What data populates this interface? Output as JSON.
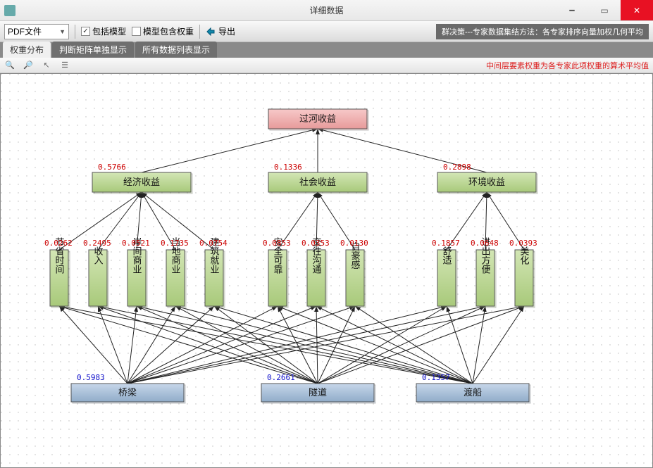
{
  "window": {
    "title": "详细数据"
  },
  "toolbar": {
    "pdf_dropdown": "PDF文件",
    "chk_include_model": "包括模型",
    "chk_include_model_checked": true,
    "chk_model_with_weights": "模型包含权重",
    "chk_model_with_weights_checked": false,
    "export_label": "导出",
    "status_right": "群决策---专家数据集结方法：各专家排序向量加权几何平均"
  },
  "tabs": {
    "t1": "权重分布",
    "t2": "判断矩阵单独显示",
    "t3": "所有数据列表显示",
    "active": 0
  },
  "hint_right": "中间层要素权重为各专家此项权重的算术平均值",
  "chart_data": {
    "type": "hierarchy-diagram",
    "goal": {
      "label": "过河收益"
    },
    "criteria": [
      {
        "id": "c1",
        "label": "经济收益",
        "weight": 0.5766
      },
      {
        "id": "c2",
        "label": "社会收益",
        "weight": 0.1336
      },
      {
        "id": "c3",
        "label": "环境收益",
        "weight": 0.2898
      }
    ],
    "subcriteria": [
      {
        "id": "s1",
        "parent": "c1",
        "label": "节省时间",
        "weight": 0.0262
      },
      {
        "id": "s2",
        "parent": "c1",
        "label": "收入",
        "weight": 0.2495
      },
      {
        "id": "s3",
        "parent": "c1",
        "label": "岸间商业",
        "weight": 0.0521
      },
      {
        "id": "s4",
        "parent": "c1",
        "label": "当地商业",
        "weight": 0.1735
      },
      {
        "id": "s5",
        "parent": "c1",
        "label": "建筑就业",
        "weight": 0.0754
      },
      {
        "id": "s6",
        "parent": "c2",
        "label": "安全可靠",
        "weight": 0.0853
      },
      {
        "id": "s7",
        "parent": "c2",
        "label": "交往沟通",
        "weight": 0.0353
      },
      {
        "id": "s8",
        "parent": "c2",
        "label": "自豪感",
        "weight": 0.013
      },
      {
        "id": "s9",
        "parent": "c3",
        "label": "舒适",
        "weight": 0.1857
      },
      {
        "id": "s10",
        "parent": "c3",
        "label": "进出方便",
        "weight": 0.0648
      },
      {
        "id": "s11",
        "parent": "c3",
        "label": "美化",
        "weight": 0.0393
      }
    ],
    "alternatives": [
      {
        "id": "a1",
        "label": "桥梁",
        "weight": 0.5983
      },
      {
        "id": "a2",
        "label": "隧道",
        "weight": 0.2661
      },
      {
        "id": "a3",
        "label": "渡船",
        "weight": 0.1357
      }
    ]
  }
}
